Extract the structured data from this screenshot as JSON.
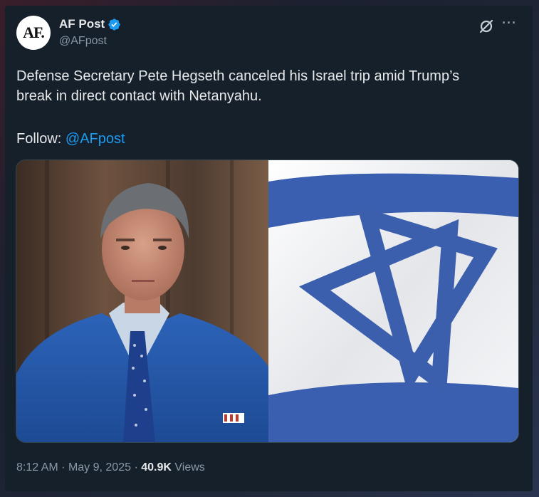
{
  "author": {
    "avatar_text": "AF.",
    "display_name": "AF Post",
    "handle": "@AFpost",
    "verified": true
  },
  "tweet": {
    "text_line1": "Defense Secretary Pete Hegseth canceled his Israel trip amid Trump’s",
    "text_line2": "break in direct contact with Netanyahu.",
    "follow_label": "Follow: ",
    "follow_mention": "@AFpost"
  },
  "media": {
    "left_image": "portrait-photo",
    "right_image": "israel-flag"
  },
  "meta": {
    "time": "8:12 AM",
    "separator": "·",
    "date": "May 9, 2025",
    "views_count": "40.9K",
    "views_label": "Views"
  },
  "icons": {
    "verified": "verified-badge-icon",
    "grok": "grok-icon",
    "more": "more-options-icon"
  },
  "colors": {
    "background": "#15202b",
    "text": "#e7e9ea",
    "muted": "#8b98a5",
    "link": "#1d9bf0",
    "flag_blue": "#3a5fb0"
  }
}
